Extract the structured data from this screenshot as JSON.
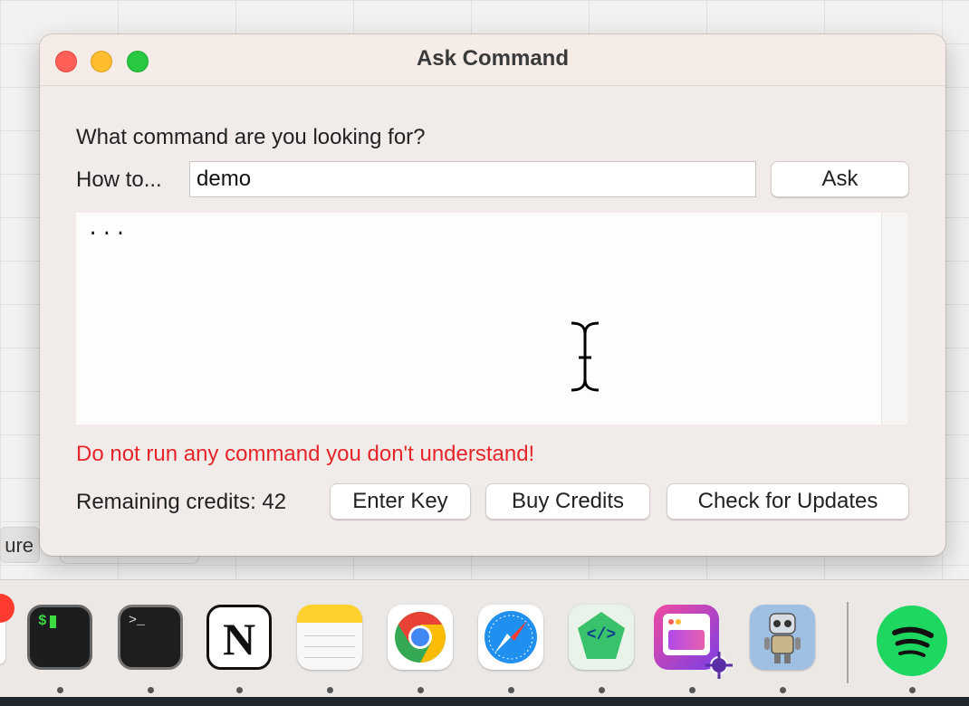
{
  "window": {
    "title": "Ask Command",
    "prompt_label": "What command are you looking for?",
    "howto_label": "How to...",
    "query_value": "demo",
    "ask_label": "Ask",
    "output_text": "...",
    "warning": "Do not run any command you don't understand!",
    "credits_label": "Remaining credits: 42",
    "enter_key_label": "Enter Key",
    "buy_credits_label": "Buy Credits",
    "check_updates_label": "Check for Updates"
  },
  "background": {
    "chip_text": "ure"
  },
  "dock": {
    "items": [
      {
        "name": "terminal-app-icon",
        "glyph": "$"
      },
      {
        "name": "terminal-prompt-icon",
        "glyph": ">_"
      },
      {
        "name": "notion-icon",
        "glyph": "N"
      },
      {
        "name": "notes-icon"
      },
      {
        "name": "chrome-icon"
      },
      {
        "name": "safari-icon"
      },
      {
        "name": "code-editor-icon",
        "glyph": "</>"
      },
      {
        "name": "screenshot-app-icon"
      },
      {
        "name": "robot-app-icon"
      },
      {
        "name": "spotify-icon"
      }
    ]
  },
  "colors": {
    "warning": "#e5252a",
    "window_bg": "#f1ece9",
    "titlebar_bg": "#f5ebe7",
    "spotify_green": "#1ed760"
  }
}
